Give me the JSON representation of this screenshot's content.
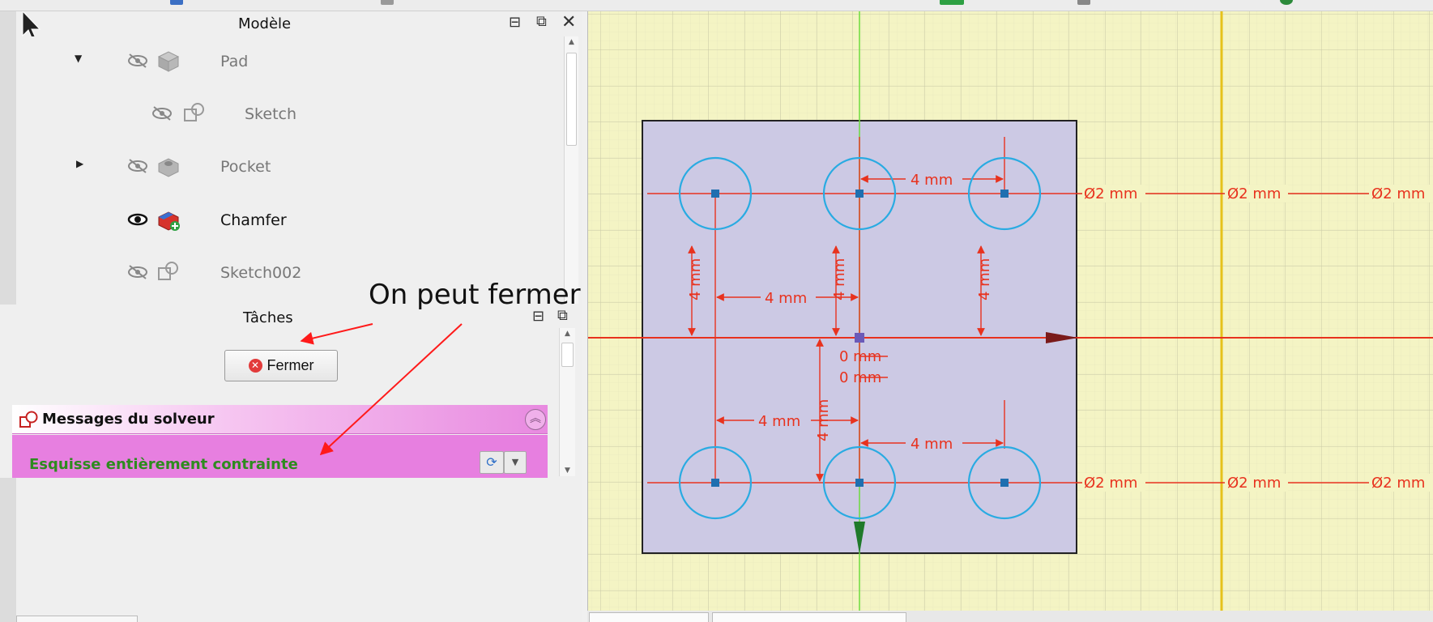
{
  "model_panel": {
    "title": "Modèle",
    "tree": [
      {
        "label": "Pad",
        "visible": false,
        "expanded": true
      },
      {
        "label": "Sketch",
        "visible": false
      },
      {
        "label": "Pocket",
        "visible": false,
        "expanded": false
      },
      {
        "label": "Chamfer",
        "visible": true
      },
      {
        "label": "Sketch002",
        "visible": false
      }
    ]
  },
  "tasks_panel": {
    "title": "Tâches",
    "close_button": "Fermer"
  },
  "solver": {
    "title": "Messages du solveur",
    "message": "Esquisse entièrement contrainte"
  },
  "annotation": {
    "text": "On peut fermer"
  },
  "sketch": {
    "dimensions": {
      "h_top_right": "4 mm",
      "v_left": "4 mm",
      "v_center": "4 mm",
      "v_right": "4 mm",
      "h_mid_left": "4 mm",
      "zero_1": "0 mm",
      "zero_2": "0 mm",
      "v_center_low": "4 mm",
      "h_low_left": "4 mm",
      "h_low_right": "4 mm",
      "dia_top_1": "Ø2 mm",
      "dia_top_2": "Ø2 mm",
      "dia_top_3": "Ø2 mm",
      "dia_bot_1": "Ø2 mm",
      "dia_bot_2": "Ø2 mm",
      "dia_bot_3": "Ø2 mm"
    },
    "colors": {
      "background": "#f4f4c4",
      "face": "#ccc9e4",
      "circles": "#29abe2",
      "constraints": "#e8321e",
      "x_axis": "#e8321e",
      "y_axis": "#6ddc3c",
      "y_line_yellow": "#e6c21c"
    }
  }
}
